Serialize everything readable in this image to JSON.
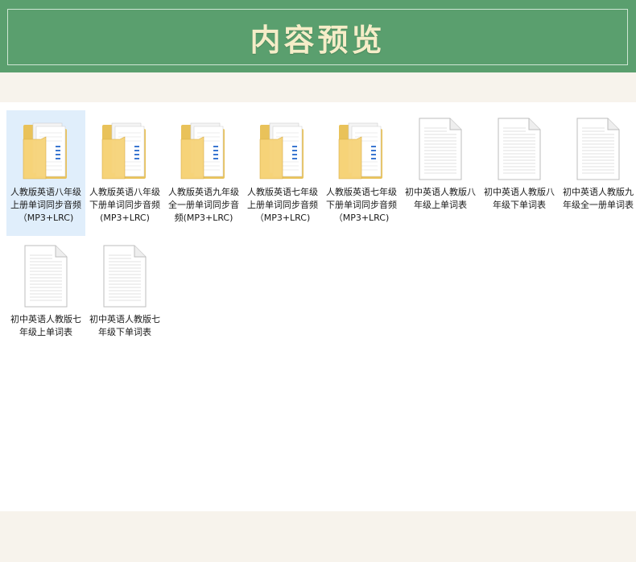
{
  "banner": {
    "title": "内容预览"
  },
  "files": [
    {
      "type": "folder",
      "label": "人教版英语八年级上册单词同步音频（MP3+LRC)",
      "selected": true
    },
    {
      "type": "folder",
      "label": "人教版英语八年级下册单词同步音频(MP3+LRC)",
      "selected": false
    },
    {
      "type": "folder",
      "label": "人教版英语九年级全一册单词同步音频(MP3+LRC)",
      "selected": false
    },
    {
      "type": "folder",
      "label": "人教版英语七年级上册单词同步音频（MP3+LRC)",
      "selected": false
    },
    {
      "type": "folder",
      "label": "人教版英语七年级下册单词同步音频（MP3+LRC)",
      "selected": false
    },
    {
      "type": "document",
      "label": "初中英语人教版八年级上单词表",
      "selected": false
    },
    {
      "type": "document",
      "label": "初中英语人教版八年级下单词表",
      "selected": false
    },
    {
      "type": "document",
      "label": "初中英语人教版九年级全一册单词表",
      "selected": false
    },
    {
      "type": "document",
      "label": "初中英语人教版七年级上单词表",
      "selected": false
    },
    {
      "type": "document",
      "label": "初中英语人教版七年级下单词表",
      "selected": false
    }
  ]
}
